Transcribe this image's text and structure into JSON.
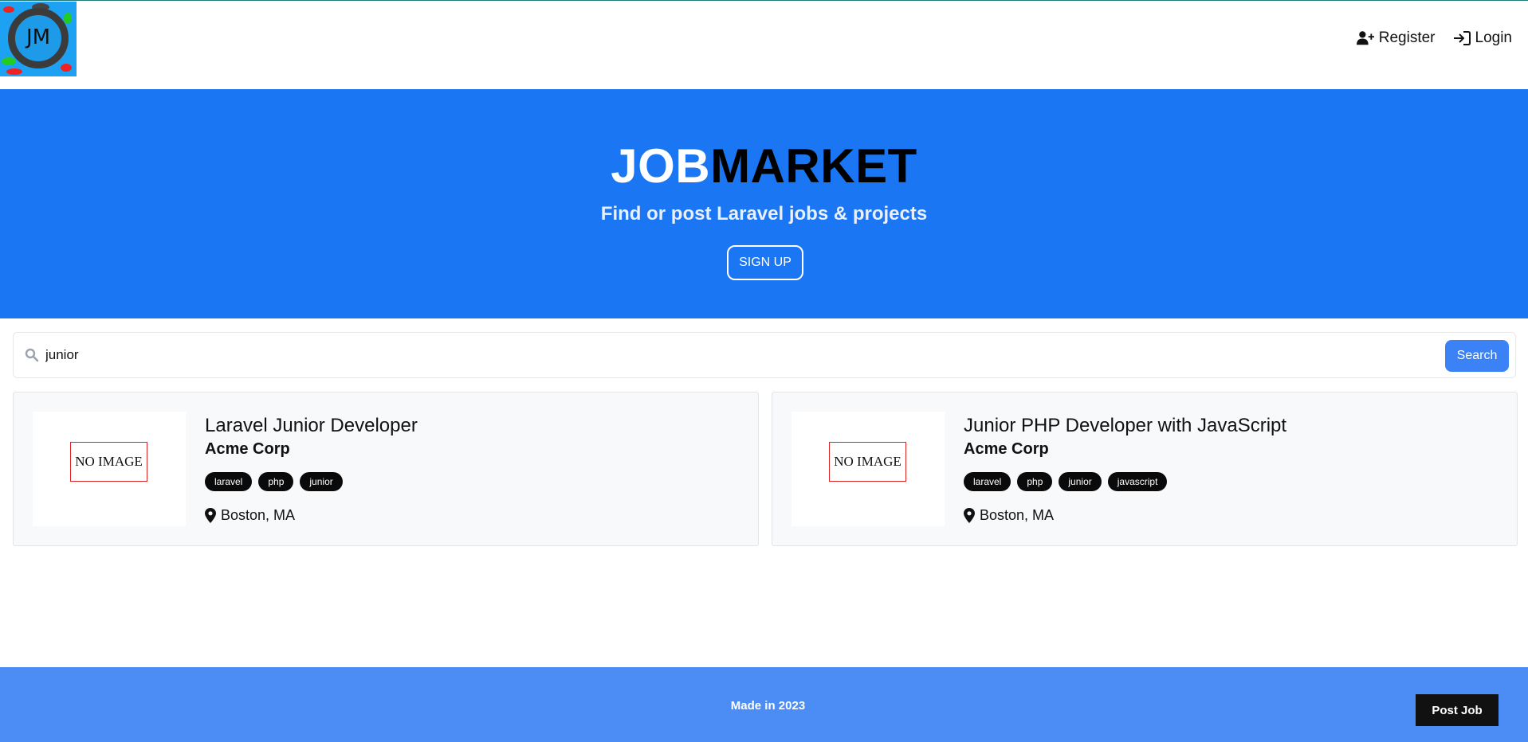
{
  "nav": {
    "logo_text": "JM",
    "register_label": "Register",
    "login_label": "Login"
  },
  "hero": {
    "brand_part1": "JOB",
    "brand_part2": "MARKET",
    "tagline": "Find or post Laravel jobs & projects",
    "signup_label": "SIGN UP"
  },
  "search": {
    "value": "junior",
    "button_label": "Search"
  },
  "listings": [
    {
      "image_text": "NO IMAGE",
      "title": "Laravel Junior Developer",
      "company": "Acme Corp",
      "tags": [
        "laravel",
        "php",
        "junior"
      ],
      "location": "Boston, MA"
    },
    {
      "image_text": "NO IMAGE",
      "title": "Junior PHP Developer with JavaScript",
      "company": "Acme Corp",
      "tags": [
        "laravel",
        "php",
        "junior",
        "javascript"
      ],
      "location": "Boston, MA"
    }
  ],
  "footer": {
    "made_text": "Made in 2023",
    "post_job_label": "Post Job"
  },
  "colors": {
    "hero_bg": "#1a76f2",
    "footer_bg": "#4c8cf5",
    "search_button": "#3b82f6",
    "tag_bg": "#0a0a0a"
  },
  "icons": {
    "register": "user-plus-icon",
    "login": "sign-in-icon",
    "search": "search-icon",
    "location": "map-pin-icon"
  }
}
